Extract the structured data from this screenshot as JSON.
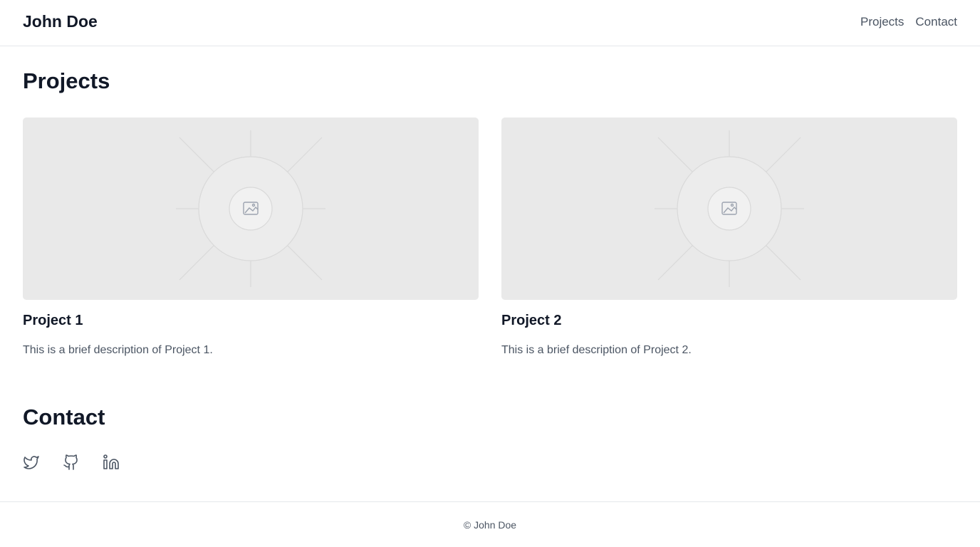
{
  "header": {
    "brand": "John Doe",
    "nav": [
      {
        "label": "Projects"
      },
      {
        "label": "Contact"
      }
    ]
  },
  "projects": {
    "heading": "Projects",
    "items": [
      {
        "title": "Project 1",
        "description": "This is a brief description of Project 1.",
        "image_icon": "image-placeholder-icon"
      },
      {
        "title": "Project 2",
        "description": "This is a brief description of Project 2.",
        "image_icon": "image-placeholder-icon"
      }
    ]
  },
  "contact": {
    "heading": "Contact",
    "links": [
      {
        "icon": "twitter-icon"
      },
      {
        "icon": "github-icon"
      },
      {
        "icon": "linkedin-icon"
      }
    ]
  },
  "footer": {
    "copyright": "© John Doe"
  },
  "colors": {
    "text": "#111827",
    "muted": "#4b5563",
    "border": "#e5e7eb",
    "placeholder_bg": "#e9e9e9"
  }
}
